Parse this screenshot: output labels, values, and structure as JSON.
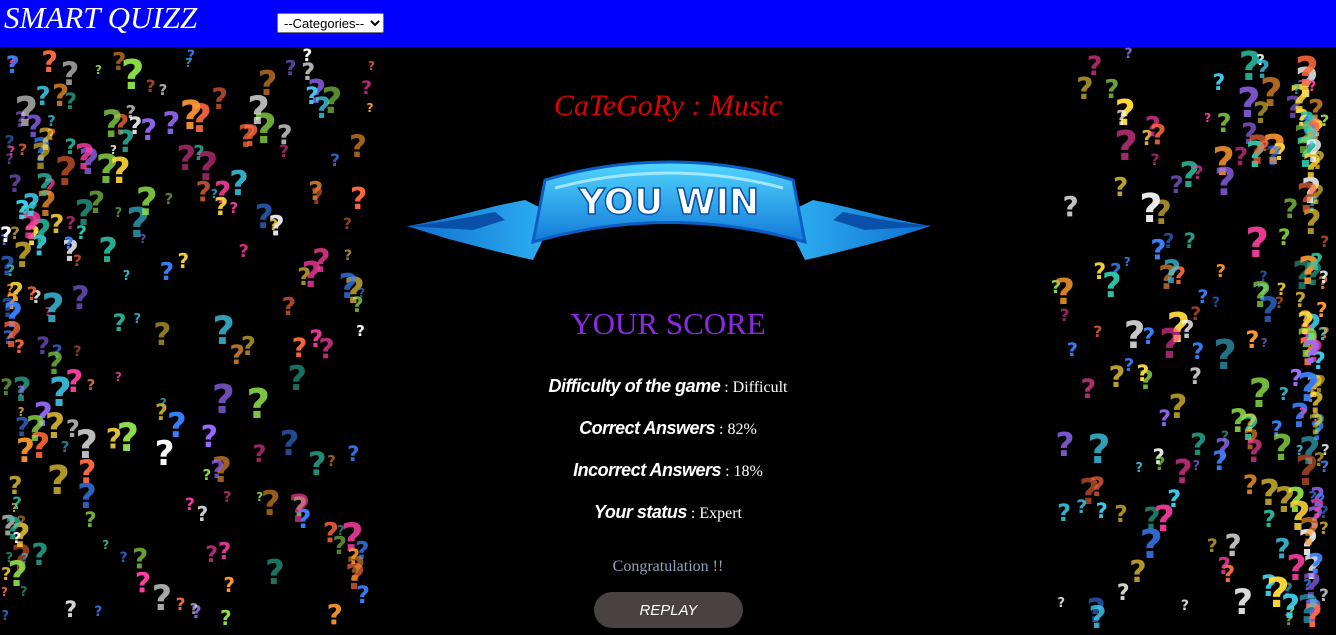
{
  "header": {
    "brand": "SMART QUIZZ",
    "categories_select": {
      "selected": "--Categories--",
      "options": [
        "--Categories--"
      ]
    }
  },
  "main": {
    "category_title": "CaTeGoRy : Music",
    "banner_text": "YOU WIN",
    "score_heading": "YOUR SCORE",
    "stats": [
      {
        "label": "Difficulty of the game",
        "separator": " : ",
        "value": "Difficult"
      },
      {
        "label": "Correct Answers",
        "separator": " : ",
        "value": "82%"
      },
      {
        "label": "Incorrect Answers",
        "separator": " : ",
        "value": "18%"
      },
      {
        "label": "Your status",
        "separator": " : ",
        "value": "Expert"
      }
    ],
    "congrats": "Congratulation !!",
    "replay_label": "REPLAY"
  },
  "colors": {
    "header_bg": "#0000ff",
    "page_bg": "#000000",
    "category_title": "#e00000",
    "score_heading": "#8a2be2",
    "congrats": "#8fa0b8",
    "replay_bg": "#4a4242",
    "banner_blue": "#1e9be8",
    "decoration_palette": [
      "#ffd93b",
      "#3fd0f0",
      "#ff6a3d",
      "#9b6bff",
      "#8ee04a",
      "#3b82ff",
      "#ff9a2e",
      "#ff3fa4",
      "#ffffff",
      "#2ec4a6"
    ]
  },
  "icons": {
    "background_decoration": "question-mark-icon",
    "select_arrow": "chevron-down-icon",
    "banner": "ribbon-banner-icon"
  }
}
